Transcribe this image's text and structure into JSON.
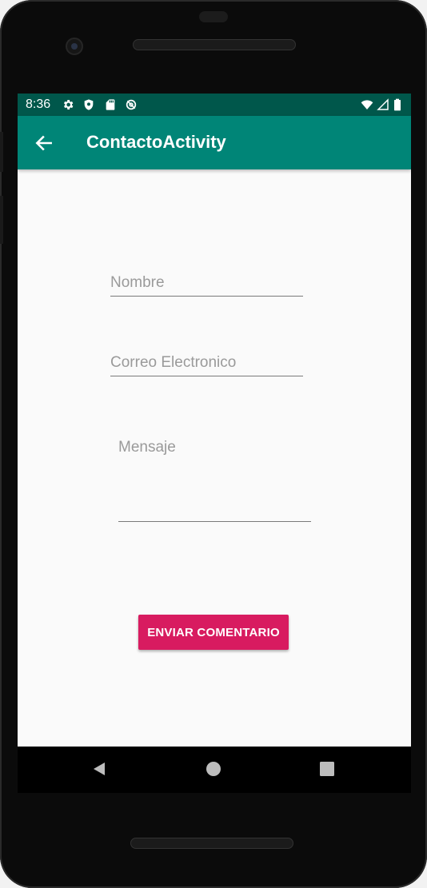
{
  "status_bar": {
    "time": "8:36",
    "background": "#00574b",
    "left_icons": [
      "settings-icon",
      "shield-icon",
      "sd-card-icon",
      "data-saver-icon"
    ],
    "right_icons": [
      "wifi-icon",
      "signal-icon",
      "battery-icon"
    ]
  },
  "app_bar": {
    "title": "ContactoActivity",
    "background": "#008577",
    "back_icon": "arrow-back-icon"
  },
  "form": {
    "name_placeholder": "Nombre",
    "email_placeholder": "Correo Electronico",
    "message_placeholder": "Mensaje",
    "submit_label": "ENVIAR COMENTARIO",
    "accent": "#d81b60"
  },
  "nav_bar": {
    "icons": [
      "nav-back-icon",
      "nav-home-icon",
      "nav-recents-icon"
    ]
  }
}
